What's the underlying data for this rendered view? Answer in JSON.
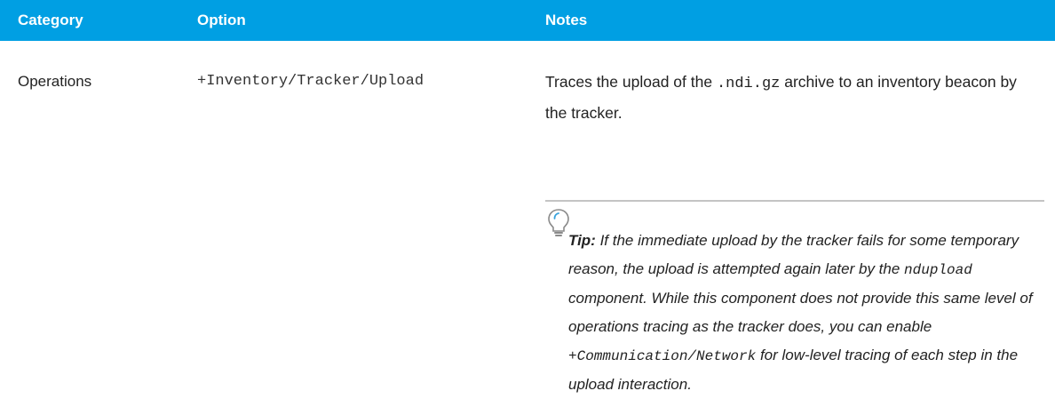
{
  "table": {
    "headers": {
      "category": "Category",
      "option": "Option",
      "notes": "Notes"
    },
    "row": {
      "category": "Operations",
      "option": "+Inventory/Tracker/Upload",
      "notes": {
        "part1": "Traces the upload of the ",
        "code": ".ndi.gz",
        "part2": " archive to an inventory beacon by the tracker."
      }
    }
  },
  "tip": {
    "icon": "lightbulb-icon",
    "label": "Tip:",
    "text1": " If the immediate upload by the tracker fails for some temporary reason, the upload is attempted again later by the ",
    "code1": "ndupload",
    "text2": " component. While this component does not provide this same level of operations tracing as the tracker does, you can enable ",
    "code2": "+Communication/Network",
    "text3": " for low-level tracing of each step in the upload interaction."
  },
  "colors": {
    "header_bg": "#009fe3",
    "header_text": "#ffffff",
    "rule": "#c4c4c4"
  }
}
